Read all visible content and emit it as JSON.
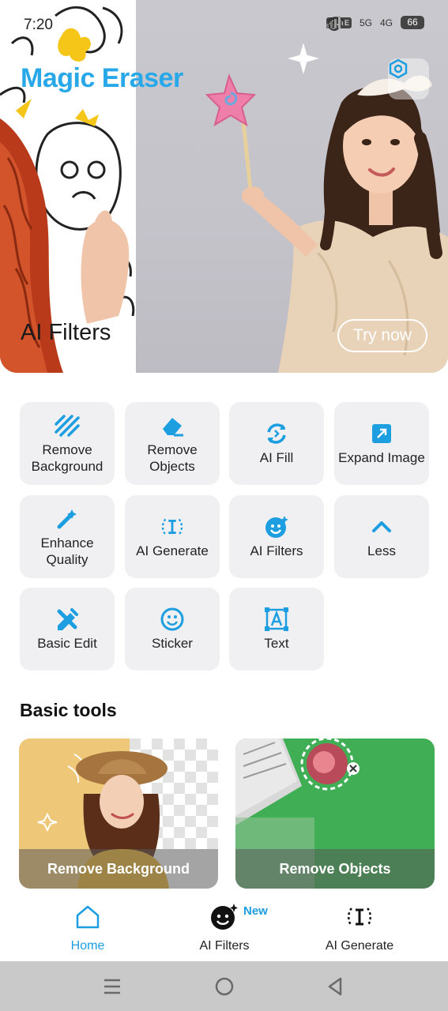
{
  "status": {
    "time": "7:20",
    "volte": "VoLTE",
    "network1": "5G",
    "network2": "4G",
    "battery": "66"
  },
  "header": {
    "app_title": "Magic Eraser",
    "settings_icon": "settings-hex-icon"
  },
  "banner": {
    "title": "AI Filters",
    "cta": "Try now"
  },
  "tools": [
    {
      "label": "Remove Background",
      "icon": "stripes-icon"
    },
    {
      "label": "Remove Objects",
      "icon": "eraser-icon"
    },
    {
      "label": "AI Fill",
      "icon": "refresh-fill-icon"
    },
    {
      "label": "Expand Image",
      "icon": "expand-icon"
    },
    {
      "label": "Enhance Quality",
      "icon": "magic-wand-icon"
    },
    {
      "label": "AI Generate",
      "icon": "text-cursor-icon"
    },
    {
      "label": "AI Filters",
      "icon": "face-filter-icon"
    },
    {
      "label": "Less",
      "icon": "chevron-up-icon"
    },
    {
      "label": "Basic Edit",
      "icon": "edit-tools-icon"
    },
    {
      "label": "Sticker",
      "icon": "smiley-icon"
    },
    {
      "label": "Text",
      "icon": "text-box-icon"
    }
  ],
  "basic_tools": {
    "title": "Basic tools",
    "cards": [
      {
        "label": "Remove Background"
      },
      {
        "label": "Remove Objects"
      }
    ]
  },
  "bottom_nav": {
    "items": [
      {
        "label": "Home",
        "icon": "home-icon",
        "active": true
      },
      {
        "label": "AI Filters",
        "icon": "face-filter-icon",
        "active": false
      },
      {
        "label": "AI Generate",
        "icon": "text-cursor-icon",
        "active": false
      }
    ],
    "new_badge": "New"
  },
  "colors": {
    "accent": "#1c9ee0",
    "title_blue": "#28a8e8",
    "tile_bg": "#f0f0f2"
  }
}
